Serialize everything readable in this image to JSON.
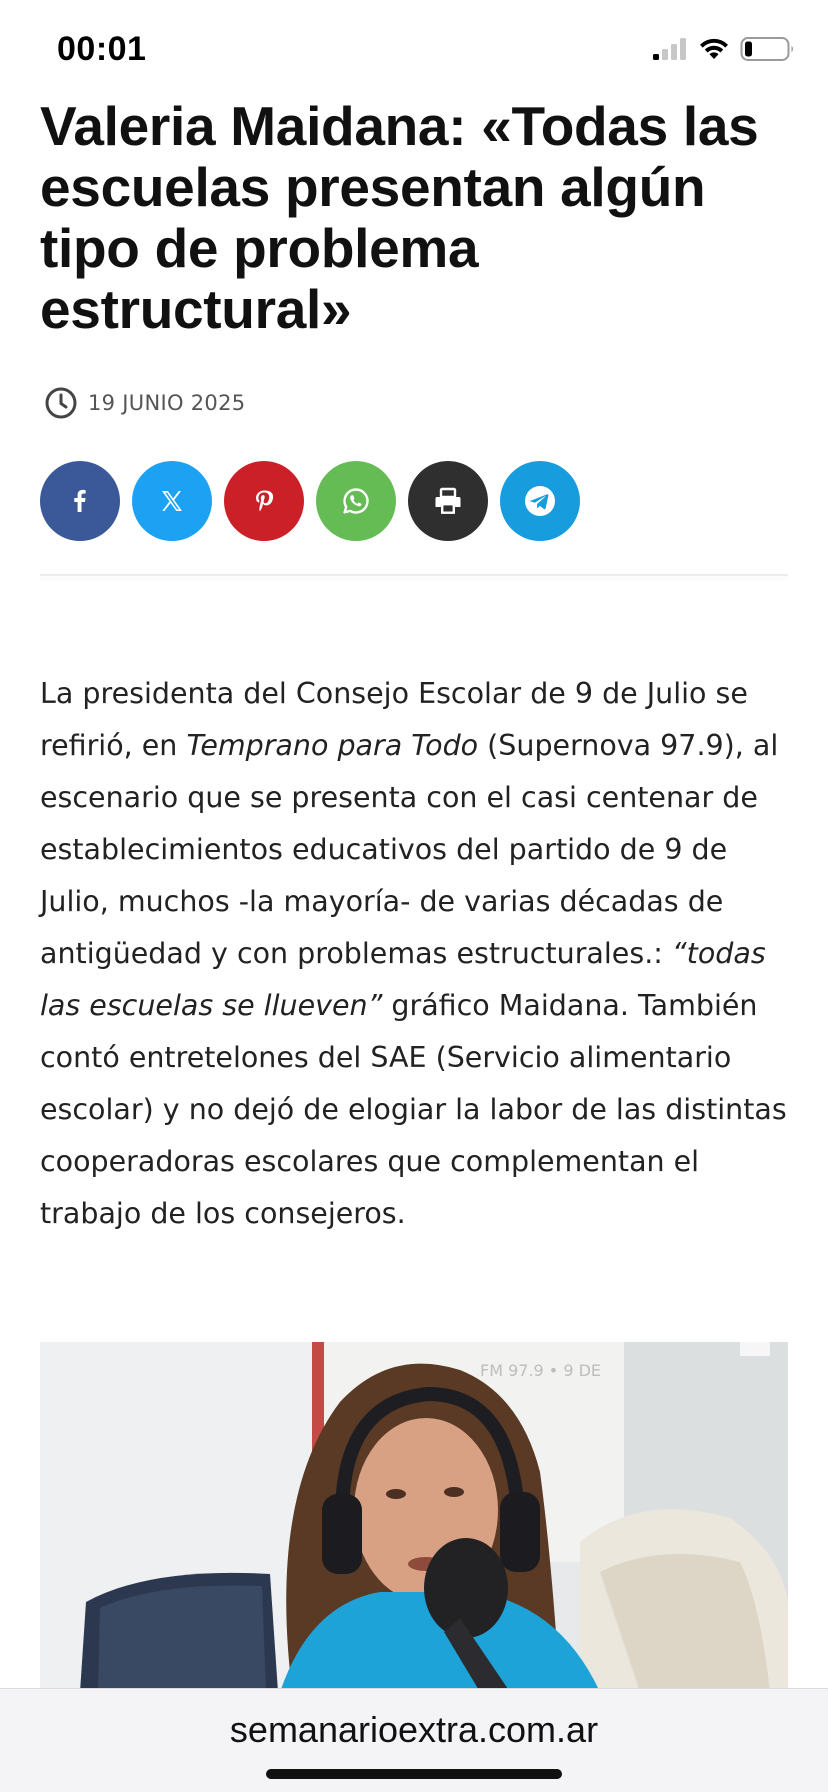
{
  "status_bar": {
    "time": "00:01"
  },
  "article": {
    "title": "Valeria Maidana: «Todas las escuelas presentan algún tipo de problema estructural»",
    "date": "19 JUNIO 2025",
    "share_buttons": [
      {
        "name": "facebook",
        "icon": "facebook-icon",
        "color": "#3b5998"
      },
      {
        "name": "x",
        "icon": "x-icon",
        "color": "#1da1f2"
      },
      {
        "name": "pinterest",
        "icon": "pinterest-icon",
        "color": "#cb2027"
      },
      {
        "name": "whatsapp",
        "icon": "whatsapp-icon",
        "color": "#65bc54"
      },
      {
        "name": "print",
        "icon": "print-icon",
        "color": "#2f2f2f"
      },
      {
        "name": "telegram",
        "icon": "telegram-icon",
        "color": "#179cde"
      }
    ],
    "body": {
      "p1_a": "La presidenta del Consejo Escolar de 9 de Julio se refirió, en ",
      "p1_em1": "Temprano para Todo",
      "p1_b": " (Supernova 97.9), al escenario que se presenta con el casi centenar de establecimientos educativos del partido de 9 de Julio, muchos -la mayoría- de varias décadas de antigüedad y con problemas estructurales.: ",
      "p1_em2": "“todas las escuelas se llueven”",
      "p1_c": " gráfico Maidana. También contó entretelones del SAE (Servicio alimentario escolar) y no dejó de elogiar la labor de las distintas cooperadoras escolares que complementan el trabajo de los consejeros."
    },
    "photo_sign_text": "FM 97.9 • 9 DE"
  },
  "browser": {
    "url": "semanarioextra.com.ar"
  }
}
